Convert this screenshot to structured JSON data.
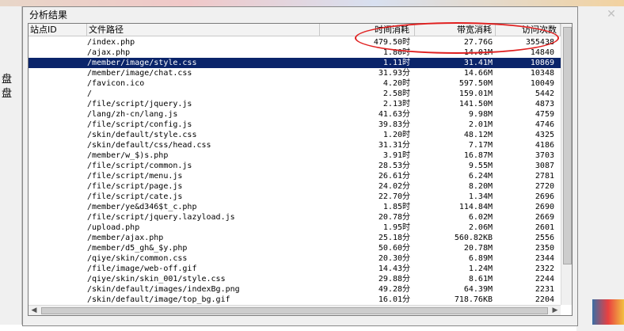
{
  "background": {
    "left_labels": [
      "盘",
      "盘"
    ],
    "close_glyph": "✕"
  },
  "dialog": {
    "title": "分析结果",
    "columns": [
      "站点ID",
      "文件路径",
      "时间消耗",
      "带宽消耗",
      "访问次数"
    ],
    "rows": [
      {
        "path": "/index.php",
        "time": "479.50时",
        "bw": "27.76G",
        "visits": "355438"
      },
      {
        "path": "/ajax.php",
        "time": "1.80时",
        "bw": "14.01M",
        "visits": "14840"
      },
      {
        "path": "/member/image/style.css",
        "time": "1.11时",
        "bw": "31.41M",
        "visits": "10869",
        "selected": true
      },
      {
        "path": "/member/image/chat.css",
        "time": "31.93分",
        "bw": "14.66M",
        "visits": "10348"
      },
      {
        "path": "/favicon.ico",
        "time": "4.20时",
        "bw": "597.50M",
        "visits": "10049"
      },
      {
        "path": "/",
        "time": "2.58时",
        "bw": "159.01M",
        "visits": "5442"
      },
      {
        "path": "/file/script/jquery.js",
        "time": "2.13时",
        "bw": "141.50M",
        "visits": "4873"
      },
      {
        "path": "/lang/zh-cn/lang.js",
        "time": "41.63分",
        "bw": "9.98M",
        "visits": "4759"
      },
      {
        "path": "/file/script/config.js",
        "time": "39.83分",
        "bw": "2.01M",
        "visits": "4746"
      },
      {
        "path": "/skin/default/style.css",
        "time": "1.20时",
        "bw": "48.12M",
        "visits": "4325"
      },
      {
        "path": "/skin/default/css/head.css",
        "time": "31.31分",
        "bw": "7.17M",
        "visits": "4186"
      },
      {
        "path": "/member/w_$)s.php",
        "time": "3.91时",
        "bw": "16.87M",
        "visits": "3703"
      },
      {
        "path": "/file/script/common.js",
        "time": "28.53分",
        "bw": "9.55M",
        "visits": "3087"
      },
      {
        "path": "/file/script/menu.js",
        "time": "26.61分",
        "bw": "6.24M",
        "visits": "2781"
      },
      {
        "path": "/file/script/page.js",
        "time": "24.02分",
        "bw": "8.20M",
        "visits": "2720"
      },
      {
        "path": "/file/script/cate.js",
        "time": "22.70分",
        "bw": "1.34M",
        "visits": "2696"
      },
      {
        "path": "/member/ye&d346$t_c.php",
        "time": "1.85时",
        "bw": "114.84M",
        "visits": "2690"
      },
      {
        "path": "/file/script/jquery.lazyload.js",
        "time": "20.78分",
        "bw": "6.02M",
        "visits": "2669"
      },
      {
        "path": "/upload.php",
        "time": "1.95时",
        "bw": "2.06M",
        "visits": "2601"
      },
      {
        "path": "/member/ajax.php",
        "time": "25.18分",
        "bw": "560.82KB",
        "visits": "2556"
      },
      {
        "path": "/member/d5_gh&_$y.php",
        "time": "50.60分",
        "bw": "20.78M",
        "visits": "2350"
      },
      {
        "path": "/qiye/skin/common.css",
        "time": "20.30分",
        "bw": "6.89M",
        "visits": "2344"
      },
      {
        "path": "/file/image/web-off.gif",
        "time": "14.43分",
        "bw": "1.24M",
        "visits": "2322"
      },
      {
        "path": "/qiye/skin/skin_001/style.css",
        "time": "29.88分",
        "bw": "8.61M",
        "visits": "2244"
      },
      {
        "path": "/skin/default/images/indexBg.png",
        "time": "49.28分",
        "bw": "64.39M",
        "visits": "2231"
      },
      {
        "path": "/skin/default/image/top_bg.gif",
        "time": "16.01分",
        "bw": "718.76KB",
        "visits": "2204"
      }
    ]
  },
  "scroll": {
    "left_arrow": "◀",
    "right_arrow": "▶"
  },
  "colors": {
    "selection": "#0a246a",
    "annotation": "#e02020"
  }
}
